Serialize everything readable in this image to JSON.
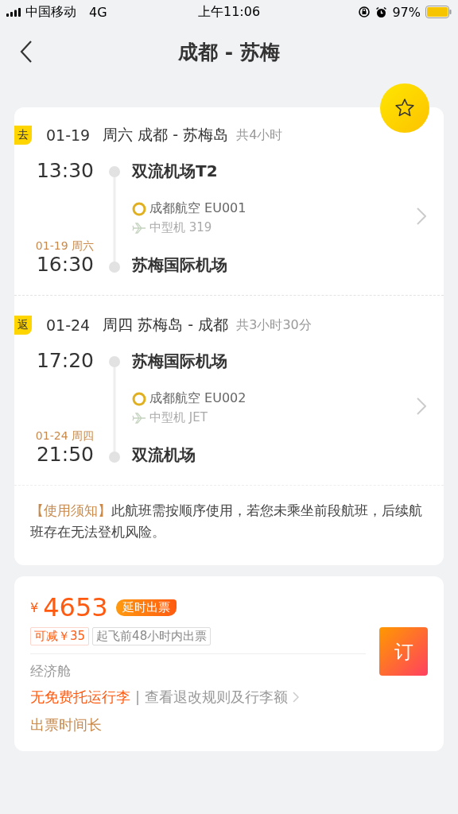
{
  "status_bar": {
    "carrier": "中国移动",
    "network": "4G",
    "time": "上午11:06",
    "battery": "97%"
  },
  "nav": {
    "title": "成都 - 苏梅"
  },
  "favorite": {
    "selected": false
  },
  "legs": [
    {
      "tag": "去",
      "date": "01-19",
      "route": "周六 成都 - 苏梅岛",
      "duration": "共4小时",
      "dep_time": "13:30",
      "dep_airport": "双流机场T2",
      "airline": "成都航空 EU001",
      "aircraft": "中型机 319",
      "arr_date": "01-19 周六",
      "arr_time": "16:30",
      "arr_airport": "苏梅国际机场"
    },
    {
      "tag": "返",
      "date": "01-24",
      "route": "周四 苏梅岛 - 成都",
      "duration": "共3小时30分",
      "dep_time": "17:20",
      "dep_airport": "苏梅国际机场",
      "airline": "成都航空 EU002",
      "aircraft": "中型机 JET",
      "arr_date": "01-24 周四",
      "arr_time": "21:50",
      "arr_airport": "双流机场"
    }
  ],
  "notice": {
    "label": "【使用须知】",
    "text": "此航班需按顺序使用，若您未乘坐前段航班，后续航班存在无法登机风险。"
  },
  "offer": {
    "currency": "¥",
    "price": "4653",
    "badge": "延时出票",
    "discount": "可减￥35",
    "ticketing": "起飞前48小时内出票",
    "cabin": "经济舱",
    "baggage": "无免费托运行李",
    "separator": "|",
    "rules": "查看退改规则及行李额",
    "slow_ticketing": "出票时间长",
    "book": "订"
  }
}
